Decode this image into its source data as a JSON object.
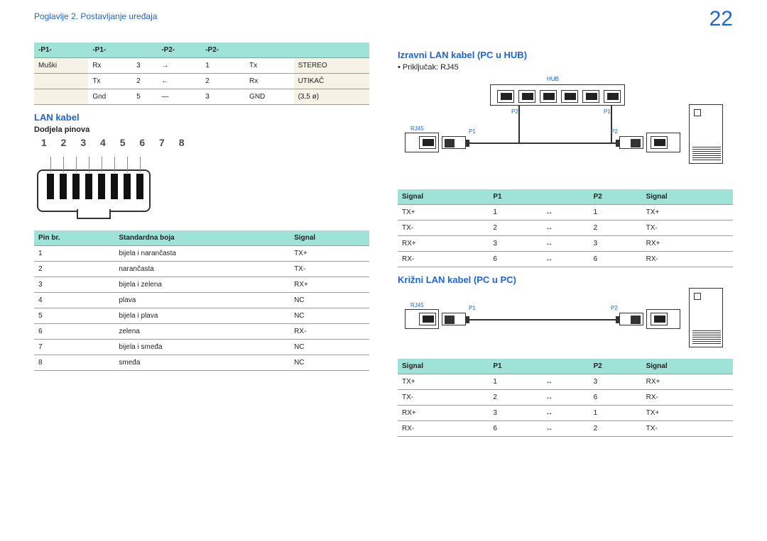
{
  "header": {
    "chapter": "Poglavlje 2. Postavljanje uređaja",
    "page": "22"
  },
  "left": {
    "table1": {
      "headers": [
        "-P1-",
        "-P1-",
        "",
        "-P2-",
        "-P2-",
        ""
      ],
      "rows": [
        [
          "Muški",
          "Rx",
          "3",
          "→",
          "1",
          "Tx",
          "STEREO"
        ],
        [
          "",
          "Tx",
          "2",
          "←",
          "2",
          "Rx",
          "UTIKAČ"
        ],
        [
          "",
          "Gnd",
          "5",
          "—",
          "3",
          "GND",
          "(3,5 ø)"
        ]
      ]
    },
    "h_lan": "LAN kabel",
    "h_pins": "Dodjela pinova",
    "pins": "1 2 3 4 5 6 7 8",
    "table2": {
      "headers": [
        "Pin br.",
        "Standardna boja",
        "Signal"
      ],
      "rows": [
        [
          "1",
          "bijela i narančasta",
          "TX+"
        ],
        [
          "2",
          "narančasta",
          "TX-"
        ],
        [
          "3",
          "bijela i zelena",
          "RX+"
        ],
        [
          "4",
          "plava",
          "NC"
        ],
        [
          "5",
          "bijela i plava",
          "NC"
        ],
        [
          "6",
          "zelena",
          "RX-"
        ],
        [
          "7",
          "bijela i smeđa",
          "NC"
        ],
        [
          "8",
          "smeđa",
          "NC"
        ]
      ]
    }
  },
  "right": {
    "h_direct": "Izravni LAN kabel (PC u HUB)",
    "bullet": "Priključak: RJ45",
    "diag_labels": {
      "hub": "HUB",
      "rj45": "RJ45",
      "p1": "P1",
      "p2": "P2"
    },
    "table3": {
      "headers": [
        "Signal",
        "P1",
        "",
        "P2",
        "Signal"
      ],
      "rows": [
        [
          "TX+",
          "1",
          "↔",
          "1",
          "TX+"
        ],
        [
          "TX-",
          "2",
          "↔",
          "2",
          "TX-"
        ],
        [
          "RX+",
          "3",
          "↔",
          "3",
          "RX+"
        ],
        [
          "RX-",
          "6",
          "↔",
          "6",
          "RX-"
        ]
      ]
    },
    "h_cross": "Križni LAN kabel (PC u PC)",
    "table4": {
      "headers": [
        "Signal",
        "P1",
        "",
        "P2",
        "Signal"
      ],
      "rows": [
        [
          "TX+",
          "1",
          "↔",
          "3",
          "RX+"
        ],
        [
          "TX-",
          "2",
          "↔",
          "6",
          "RX-"
        ],
        [
          "RX+",
          "3",
          "↔",
          "1",
          "TX+"
        ],
        [
          "RX-",
          "6",
          "↔",
          "2",
          "TX-"
        ]
      ]
    }
  }
}
